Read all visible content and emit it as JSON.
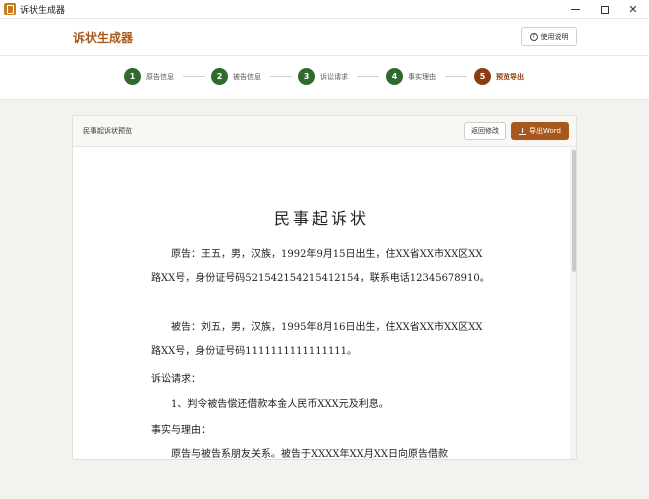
{
  "window": {
    "title": "诉状生成器"
  },
  "header": {
    "app_title": "诉状生成器",
    "help_label": "使用说明"
  },
  "steps": [
    {
      "number": "1",
      "label": "原告信息",
      "status": "done"
    },
    {
      "number": "2",
      "label": "被告信息",
      "status": "done"
    },
    {
      "number": "3",
      "label": "诉讼请求",
      "status": "done"
    },
    {
      "number": "4",
      "label": "事实理由",
      "status": "done"
    },
    {
      "number": "5",
      "label": "预览导出",
      "status": "active"
    }
  ],
  "preview": {
    "card_title": "民事起诉状预览",
    "back_label": "返回修改",
    "export_label": "导出Word"
  },
  "document": {
    "title": "民事起诉状",
    "plaintiff": "原告：王五，男，汉族，1992年9月15日出生，住XX省XX市XX区XX路XX号，身份证号码521542154215412154，联系电话12345678910。",
    "defendant": "被告：刘五，男，汉族，1995年8月16日出生，住XX省XX市XX区XX路XX号，身份证号码1111111111111111。",
    "claims_heading": "诉讼请求：",
    "claim_1": "1、判令被告偿还借款本金人民币XXX元及利息。",
    "facts_heading": "事实与理由：",
    "facts_text": "原告与被告系朋友关系。被告于XXXX年XX月XX日向原告借款"
  },
  "colors": {
    "brand": "#a8581d",
    "step_done": "#2f6b2f",
    "step_active": "#8a3d14"
  }
}
